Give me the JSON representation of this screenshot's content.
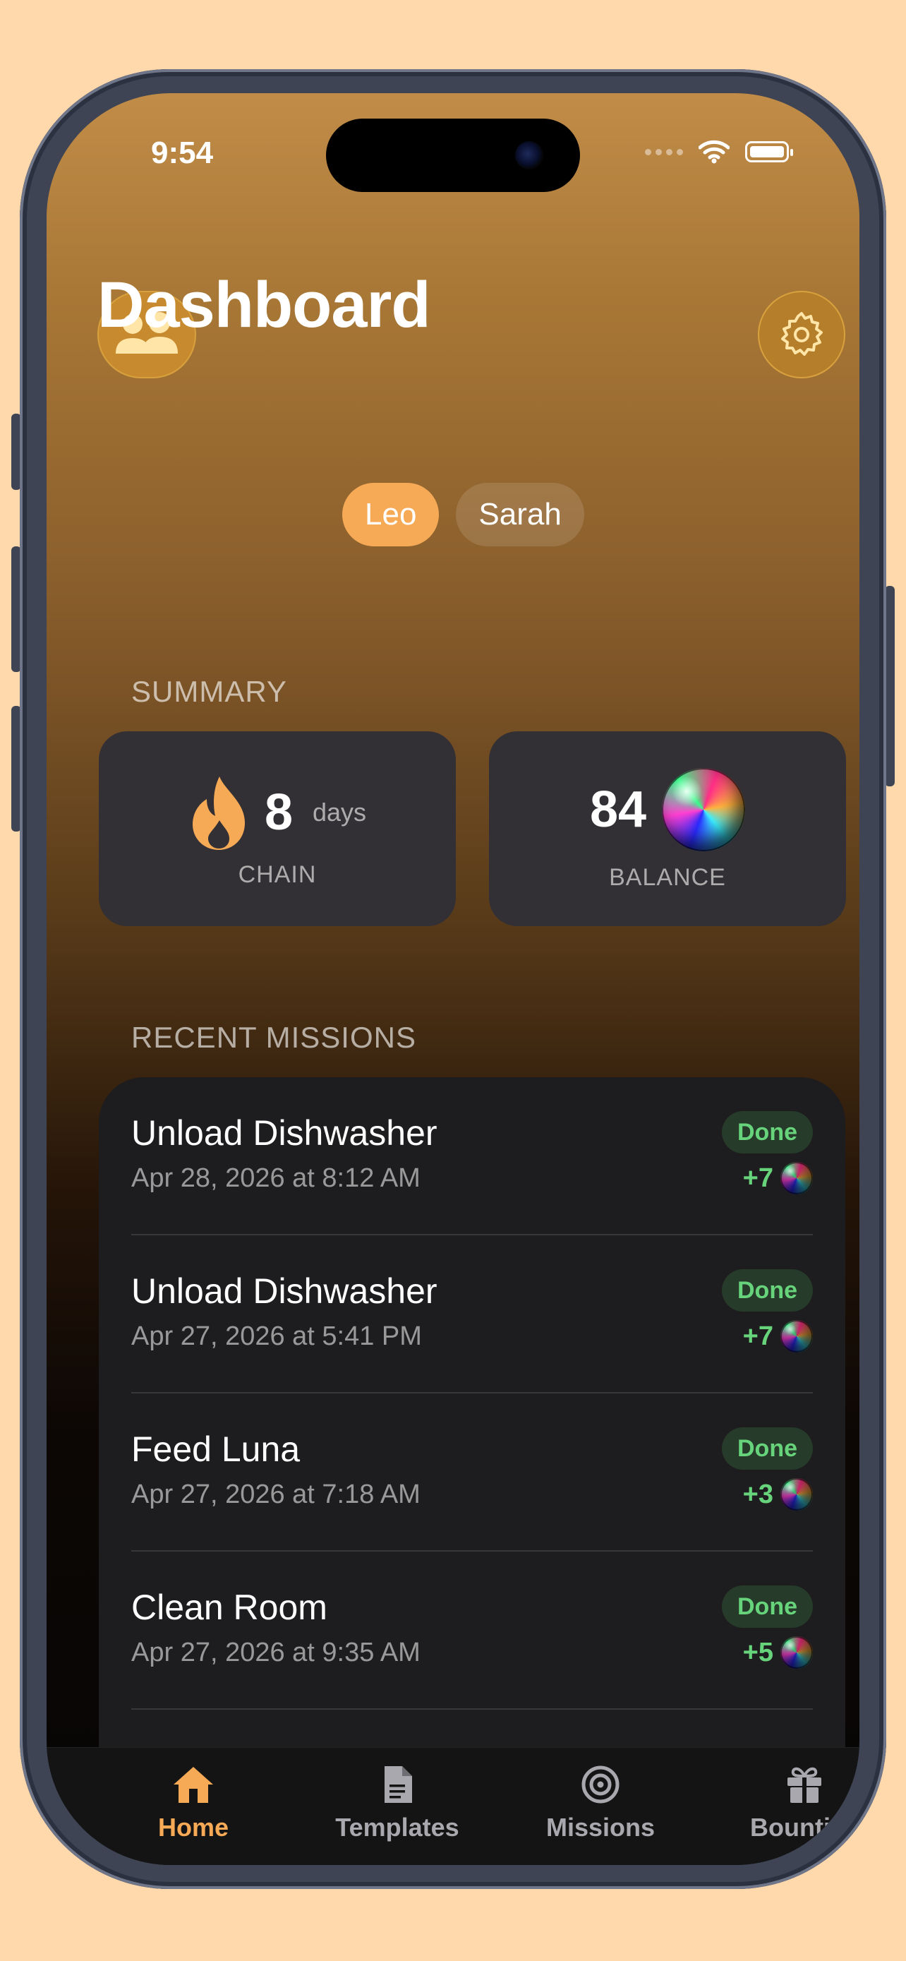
{
  "status": {
    "time": "9:54"
  },
  "header": {
    "title": "Dashboard"
  },
  "users": [
    "Leo",
    "Sarah"
  ],
  "selected_user": "Leo",
  "summary": {
    "label": "SUMMARY",
    "chain": {
      "value": "8",
      "unit": "days",
      "label": "CHAIN"
    },
    "balance": {
      "value": "84",
      "label": "BALANCE"
    }
  },
  "recent": {
    "label": "RECENT MISSIONS",
    "items": [
      {
        "name": "Unload Dishwasher",
        "date": "Apr 28, 2026 at 8:12 AM",
        "status": "Done",
        "points": "+7"
      },
      {
        "name": "Unload Dishwasher",
        "date": "Apr 27, 2026 at 5:41 PM",
        "status": "Done",
        "points": "+7"
      },
      {
        "name": "Feed Luna",
        "date": "Apr 27, 2026 at 7:18 AM",
        "status": "Done",
        "points": "+3"
      },
      {
        "name": "Clean Room",
        "date": "Apr 27, 2026 at 9:35 AM",
        "status": "Done",
        "points": "+5"
      }
    ]
  },
  "tabs": [
    {
      "label": "Home",
      "icon": "house-icon",
      "active": true
    },
    {
      "label": "Templates",
      "icon": "document-icon",
      "active": false
    },
    {
      "label": "Missions",
      "icon": "target-icon",
      "active": false
    },
    {
      "label": "Bounties",
      "icon": "gift-icon",
      "active": false
    }
  ],
  "colors": {
    "accent": "#F7AA56",
    "done": "#67D47B",
    "card": "#323034",
    "list": "#1D1D1F"
  }
}
